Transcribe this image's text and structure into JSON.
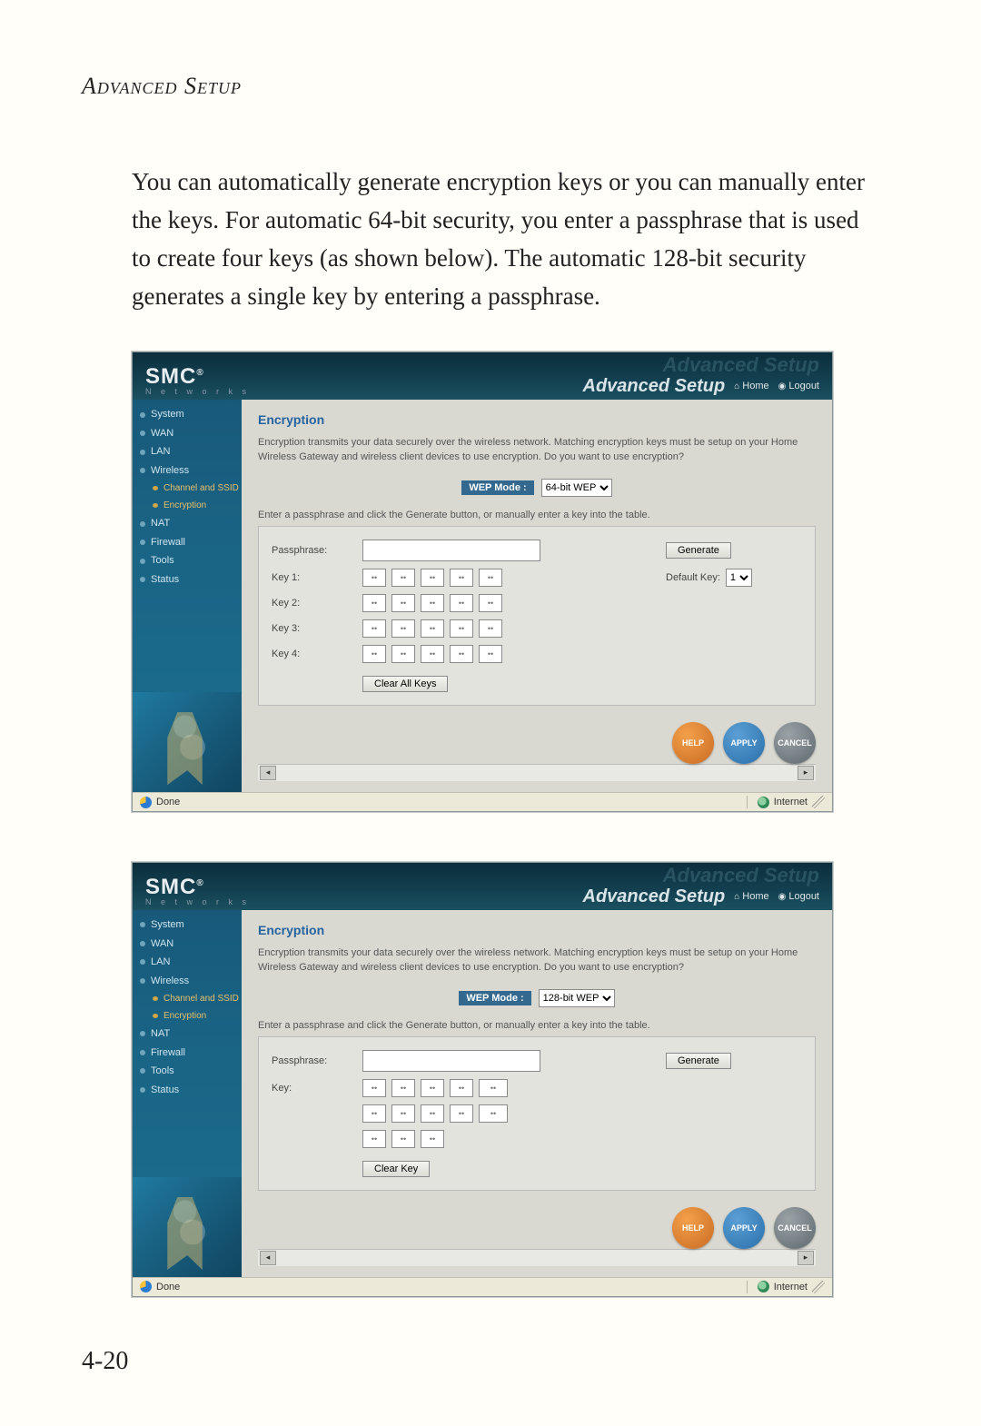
{
  "doc": {
    "heading": "Advanced Setup",
    "intro": "You can automatically generate encryption keys or you can manually enter the keys. For automatic 64-bit security, you enter a passphrase that is used to create four keys (as shown below). The automatic 128-bit security generates a single key by entering a passphrase.",
    "page_number": "4-20"
  },
  "brand": {
    "smc": "SMC",
    "reg": "®",
    "networks": "N e t w o r k s",
    "ghost": "Advanced Setup",
    "setup": "Advanced Setup",
    "home": "Home",
    "logout": "Logout"
  },
  "sidebar": {
    "items": [
      "System",
      "WAN",
      "LAN",
      "Wireless"
    ],
    "subitems": [
      "Channel and SSID",
      "Encryption"
    ],
    "items2": [
      "NAT",
      "Firewall",
      "Tools",
      "Status"
    ]
  },
  "content": {
    "title": "Encryption",
    "desc": "Encryption transmits your data securely over the wireless network. Matching encryption keys must be setup on your Home Wireless Gateway and wireless client devices to use encryption. Do you want to use encryption?",
    "wep_label": "WEP Mode :",
    "instr": "Enter a passphrase and click the Generate button, or manually enter a key into the table.",
    "passphrase": "Passphrase:",
    "generate": "Generate"
  },
  "screen64": {
    "wep_mode": "64-bit WEP",
    "key_labels": [
      "Key 1:",
      "Key 2:",
      "Key 3:",
      "Key 4:"
    ],
    "default_key_label": "Default Key:",
    "default_key_value": "1",
    "clear": "Clear All Keys"
  },
  "screen128": {
    "wep_mode": "128-bit WEP",
    "key_label": "Key:",
    "clear": "Clear Key"
  },
  "buttons": {
    "help": "HELP",
    "apply": "APPLY",
    "cancel": "CANCEL"
  },
  "status": {
    "done": "Done",
    "zone": "Internet"
  },
  "cell_placeholder": "••"
}
